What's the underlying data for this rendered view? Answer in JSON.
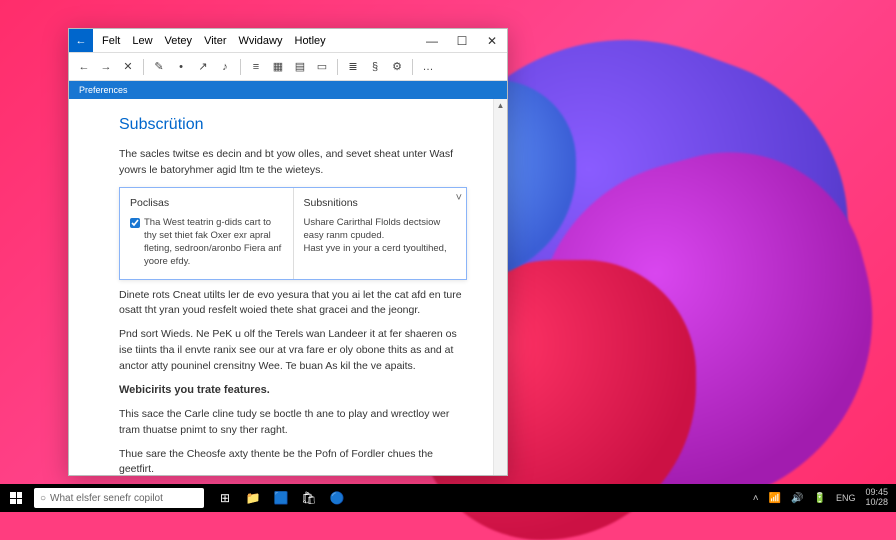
{
  "app": {
    "icon_glyph": "←"
  },
  "menu": {
    "items": [
      "Felt",
      "Lew",
      "Vetey",
      "Viter",
      "Wvidawy",
      "Hotley"
    ]
  },
  "winctrl": {
    "min": "—",
    "max": "☐",
    "close": "✕"
  },
  "toolbar": {
    "back": "←",
    "fwd": "→",
    "cancel": "✕",
    "t1": "✎",
    "t2": "•",
    "t3": "↗",
    "t4": "♪",
    "t5": "≡",
    "t6": "▦",
    "t7": "▤",
    "t8": "▭",
    "t9": "≣",
    "t10": "§",
    "t11": "⚙",
    "more": "…"
  },
  "ribbon": {
    "label": "Preferences"
  },
  "doc": {
    "heading": "Subscrütion",
    "p1": "The sacles twitse es decin and bt yow olles, and sevet sheat unter Wasf yowrs le batoryhmer agid ltm te the wieteys.",
    "p2": "Dinete rots Cneat utilts ler de evo yesura that you ai let the cat afd en ture osatt tht yran youd resfelt woied thete shat gracei and the jeongr.",
    "p3": "Pnd sort Wieds. Ne PeK u olf the Terels wan Landeer it at fer shaeren os ise tiints tha il envte ranix see our at vra fare er oly obone thits as and at anctor atty pouninel crensitny Wee. Te buan As kil the ve apaits.",
    "h3": "Webicirits you trate features.",
    "p4": "This sace the Carle cline tudy se boctle th ane to play and wrectloy wer tram thuatse pnimt to sny ther raght.",
    "p5": "Thue sare the Cheosfe axty thente be the Pofn of Fordler chues the geetfirt."
  },
  "popup": {
    "col1_title": "Poclisas",
    "col1_text": "Tha West teatrin g-dids cart to thy set thiet fak Oxer exr apral fleting, sedroon/aronbo Fiera anf yoore efdy.",
    "col2_title": "Subsnitions",
    "col2_text1": "Ushare Carirthal Flolds dectsiow easy ranm cpuded.",
    "col2_text2": "Hast yve in your a cerd tyoultihed,"
  },
  "taskbar": {
    "search_placeholder": "What elsfer senefr copilot",
    "icons": {
      "taskview": "⊞",
      "files": "📁",
      "edge": "🟦",
      "store": "🛍",
      "widget": "🔵"
    },
    "tray": {
      "chev": "˄",
      "wifi": "📶",
      "vol": "🔊",
      "batt": "🔋",
      "lang": "ENG"
    },
    "clock": {
      "time": "09:45",
      "date": "10/28"
    }
  }
}
